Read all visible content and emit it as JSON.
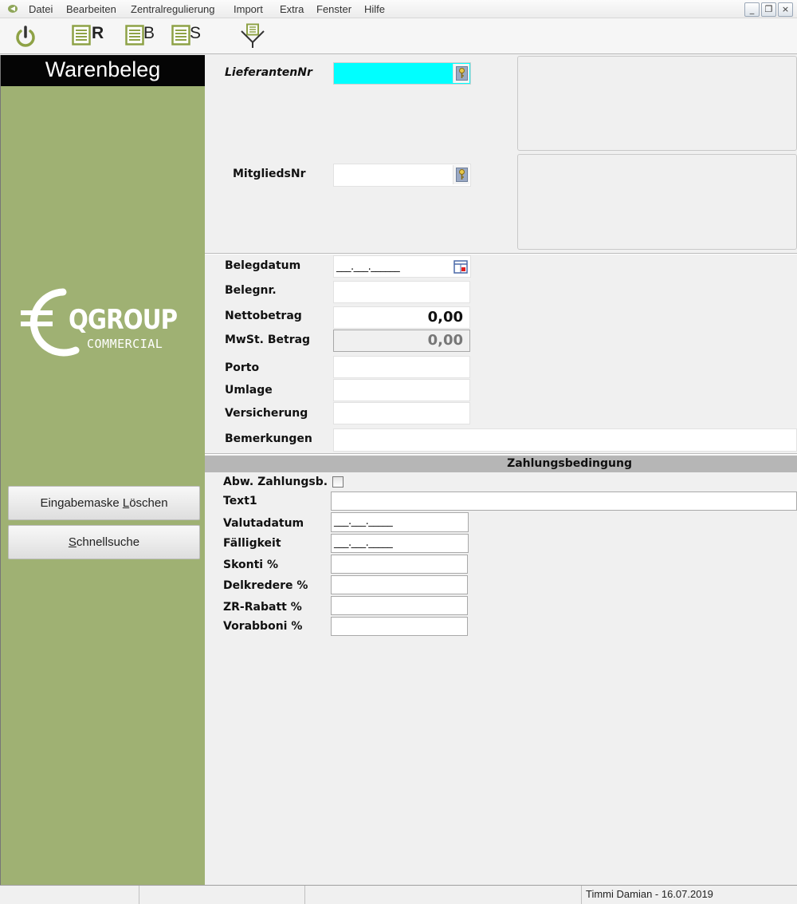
{
  "menubar": {
    "items": [
      "Datei",
      "Bearbeiten",
      "Zentralregulierung",
      "Import",
      "Extra",
      "Fenster",
      "Hilfe"
    ],
    "window_buttons": {
      "minimize": "_",
      "restore": "❐",
      "close": "×"
    }
  },
  "toolbar": {
    "items": [
      {
        "icon": "power-icon",
        "letter": ""
      },
      {
        "icon": "document-lines-icon",
        "letter": "R"
      },
      {
        "icon": "document-lines-icon",
        "letter": "B"
      },
      {
        "icon": "document-lines-icon",
        "letter": "S"
      },
      {
        "icon": "funnel-filter-icon",
        "letter": ""
      }
    ]
  },
  "sidebar": {
    "title": "Warenbeleg",
    "logo": {
      "name": "QGROUP",
      "sub": "COMMERCIAL"
    },
    "buttons": {
      "clear": {
        "pre": "Eingabemaske ",
        "accel": "L",
        "post": "öschen"
      },
      "quicksearch": {
        "pre": "",
        "accel": "S",
        "post": "chnellsuche"
      }
    }
  },
  "form": {
    "lieferanten_nr": {
      "label": "LieferantenNr",
      "value": ""
    },
    "mitglieds_nr": {
      "label": "MitgliedsNr",
      "value": ""
    },
    "belegdatum": {
      "label": "Belegdatum",
      "value": "___.___.______"
    },
    "belegnr": {
      "label": "Belegnr.",
      "value": ""
    },
    "nettobetrag": {
      "label": "Nettobetrag",
      "value": "0,00"
    },
    "mwst_betrag": {
      "label": "MwSt. Betrag",
      "value": "0,00"
    },
    "porto": {
      "label": "Porto",
      "value": ""
    },
    "umlage": {
      "label": "Umlage",
      "value": ""
    },
    "versicherung": {
      "label": "Versicherung",
      "value": ""
    },
    "bemerkungen": {
      "label": "Bemerkungen",
      "value": ""
    }
  },
  "zahlungsbedingung": {
    "header": "Zahlungsbedingung",
    "abw": {
      "label": "Abw. Zahlungsb.",
      "checked": false
    },
    "text1": {
      "label": "Text1",
      "value": ""
    },
    "valutadatum": {
      "label": "Valutadatum",
      "value": "___.___._____"
    },
    "faelligkeit": {
      "label": "Fälligkeit",
      "value": "___.___._____"
    },
    "skonti": {
      "label": "Skonti %",
      "value": ""
    },
    "delkredere": {
      "label": "Delkredere %",
      "value": ""
    },
    "zr_rabatt": {
      "label": "ZR-Rabatt %",
      "value": ""
    },
    "vorabboni": {
      "label": "Vorabboni %",
      "value": ""
    }
  },
  "statusbar": {
    "cells": [
      "",
      "",
      "",
      "Timmi Damian - 16.07.2019"
    ]
  },
  "colors": {
    "sidebar": "#9fb173",
    "highlight_field": "#00ffff",
    "title_bg": "#050505"
  }
}
